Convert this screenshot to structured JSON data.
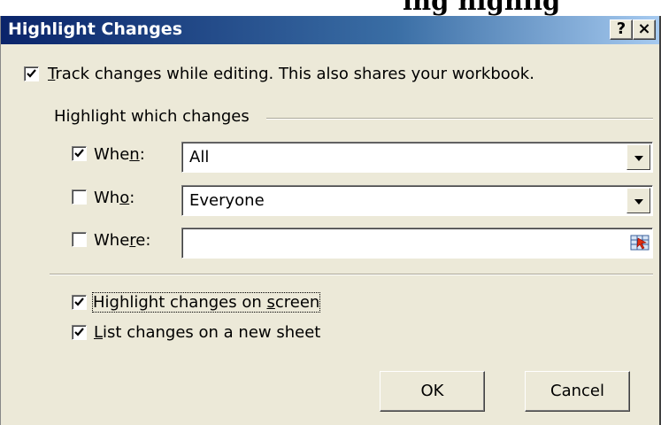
{
  "heading_fragment": "ing highlig",
  "window": {
    "title": "Highlight Changes",
    "help_button": "?",
    "close_button": "×"
  },
  "track": {
    "checked": true,
    "label_mnemonic": "T",
    "label_rest": "rack changes while editing. This also shares your workbook."
  },
  "group": {
    "title": "Highlight which changes"
  },
  "when": {
    "checked": true,
    "label_pre": "Whe",
    "label_mnemonic": "n",
    "label_post": ":",
    "value": "All"
  },
  "who": {
    "checked": false,
    "label_pre": "Wh",
    "label_mnemonic": "o",
    "label_post": ":",
    "value": "Everyone"
  },
  "where": {
    "checked": false,
    "label_pre": "Whe",
    "label_mnemonic": "r",
    "label_post": "e:",
    "value": ""
  },
  "highlight_screen": {
    "checked": true,
    "label_pre": "Highlight changes on ",
    "label_mnemonic": "s",
    "label_post": "creen"
  },
  "list_sheet": {
    "checked": true,
    "label_mnemonic": "L",
    "label_rest": "ist changes on a new sheet"
  },
  "buttons": {
    "ok": "OK",
    "cancel": "Cancel"
  }
}
